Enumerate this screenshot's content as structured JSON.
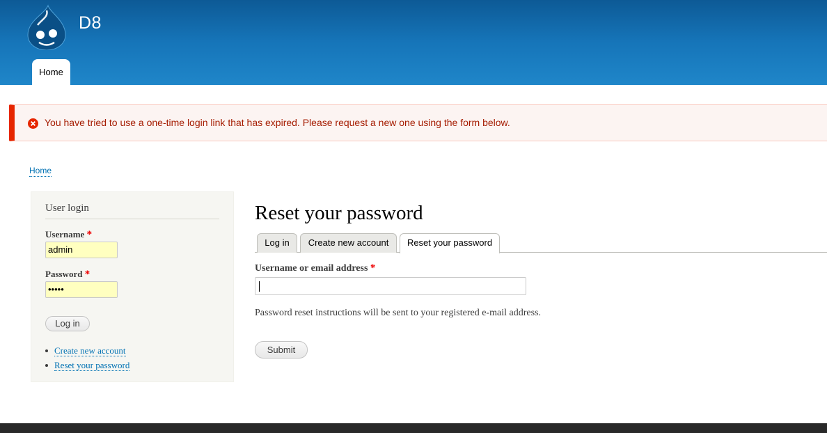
{
  "site": {
    "name": "D8",
    "logo_icon": "drupal-drop-icon",
    "primary_tab": "Home"
  },
  "message": {
    "icon": "error-circle-icon",
    "text": "You have tried to use a one-time login link that has expired. Please request a new one using the form below.",
    "color": "#a51b00",
    "border_color": "#e62600"
  },
  "breadcrumb": {
    "home": "Home"
  },
  "sidebar": {
    "title": "User login",
    "username_label": "Username",
    "username_value": "admin",
    "password_label": "Password",
    "password_value": "•••••",
    "required_mark": "*",
    "login_button": "Log in",
    "links": {
      "create_account": "Create new account",
      "reset_password": "Reset your password"
    }
  },
  "main": {
    "title": "Reset your password",
    "tabs": {
      "login": "Log in",
      "create": "Create new account",
      "reset": "Reset your password"
    },
    "field_label": "Username or email address",
    "required_mark": "*",
    "field_value": "",
    "description": "Password reset instructions will be sent to your registered e-mail address.",
    "submit_button": "Submit"
  },
  "colors": {
    "header_top": "#0d5a96",
    "header_bottom": "#1f86c9",
    "link": "#0071b3",
    "footer": "#292929"
  }
}
